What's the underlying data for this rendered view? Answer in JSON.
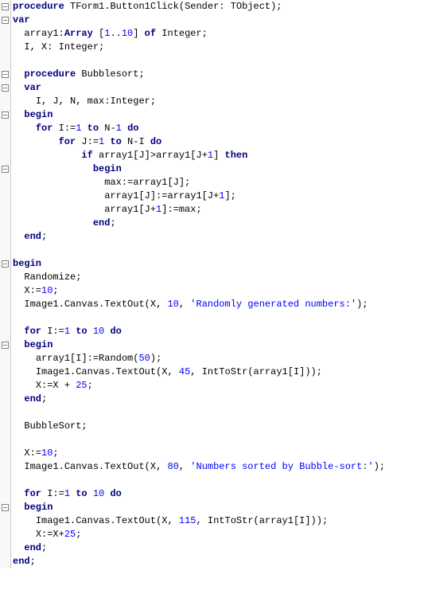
{
  "code": {
    "lines": [
      {
        "fold": true,
        "indent": 0,
        "tokens": [
          [
            "kw",
            "procedure"
          ],
          [
            "op",
            " "
          ],
          [
            "ident",
            "TForm1"
          ],
          [
            "op",
            "."
          ],
          [
            "ident",
            "Button1Click"
          ],
          [
            "op",
            "("
          ],
          [
            "ident",
            "Sender"
          ],
          [
            "op",
            ": "
          ],
          [
            "ident",
            "TObject"
          ],
          [
            "op",
            ");"
          ]
        ]
      },
      {
        "fold": true,
        "indent": 0,
        "tokens": [
          [
            "kw",
            "var"
          ]
        ]
      },
      {
        "fold": false,
        "indent": 2,
        "tokens": [
          [
            "ident",
            "array1"
          ],
          [
            "op",
            ":"
          ],
          [
            "kw",
            "Array"
          ],
          [
            "op",
            " ["
          ],
          [
            "num",
            "1"
          ],
          [
            "op",
            ".."
          ],
          [
            "num",
            "10"
          ],
          [
            "op",
            "] "
          ],
          [
            "kw",
            "of"
          ],
          [
            "op",
            " "
          ],
          [
            "ident",
            "Integer"
          ],
          [
            "op",
            ";"
          ]
        ]
      },
      {
        "fold": false,
        "indent": 2,
        "tokens": [
          [
            "ident",
            "I"
          ],
          [
            "op",
            ", "
          ],
          [
            "ident",
            "X"
          ],
          [
            "op",
            ": "
          ],
          [
            "ident",
            "Integer"
          ],
          [
            "op",
            ";"
          ]
        ]
      },
      {
        "fold": false,
        "indent": 0,
        "tokens": []
      },
      {
        "fold": true,
        "indent": 2,
        "tokens": [
          [
            "kw",
            "procedure"
          ],
          [
            "op",
            " "
          ],
          [
            "ident",
            "Bubblesort"
          ],
          [
            "op",
            ";"
          ]
        ]
      },
      {
        "fold": true,
        "indent": 2,
        "tokens": [
          [
            "kw",
            "var"
          ]
        ]
      },
      {
        "fold": false,
        "indent": 4,
        "tokens": [
          [
            "ident",
            "I"
          ],
          [
            "op",
            ", "
          ],
          [
            "ident",
            "J"
          ],
          [
            "op",
            ", "
          ],
          [
            "ident",
            "N"
          ],
          [
            "op",
            ", "
          ],
          [
            "ident",
            "max"
          ],
          [
            "op",
            ":"
          ],
          [
            "ident",
            "Integer"
          ],
          [
            "op",
            ";"
          ]
        ]
      },
      {
        "fold": true,
        "indent": 2,
        "tokens": [
          [
            "kw",
            "begin"
          ]
        ]
      },
      {
        "fold": false,
        "indent": 4,
        "tokens": [
          [
            "kw",
            "for"
          ],
          [
            "op",
            " "
          ],
          [
            "ident",
            "I"
          ],
          [
            "op",
            ":="
          ],
          [
            "num",
            "1"
          ],
          [
            "op",
            " "
          ],
          [
            "kw",
            "to"
          ],
          [
            "op",
            " "
          ],
          [
            "ident",
            "N"
          ],
          [
            "op",
            "-"
          ],
          [
            "num",
            "1"
          ],
          [
            "op",
            " "
          ],
          [
            "kw",
            "do"
          ]
        ]
      },
      {
        "fold": false,
        "indent": 8,
        "tokens": [
          [
            "kw",
            "for"
          ],
          [
            "op",
            " "
          ],
          [
            "ident",
            "J"
          ],
          [
            "op",
            ":="
          ],
          [
            "num",
            "1"
          ],
          [
            "op",
            " "
          ],
          [
            "kw",
            "to"
          ],
          [
            "op",
            " "
          ],
          [
            "ident",
            "N"
          ],
          [
            "op",
            "-"
          ],
          [
            "ident",
            "I"
          ],
          [
            "op",
            " "
          ],
          [
            "kw",
            "do"
          ]
        ]
      },
      {
        "fold": false,
        "indent": 12,
        "tokens": [
          [
            "kw",
            "if"
          ],
          [
            "op",
            " "
          ],
          [
            "ident",
            "array1"
          ],
          [
            "op",
            "["
          ],
          [
            "ident",
            "J"
          ],
          [
            "op",
            "]>"
          ],
          [
            "ident",
            "array1"
          ],
          [
            "op",
            "["
          ],
          [
            "ident",
            "J"
          ],
          [
            "op",
            "+"
          ],
          [
            "num",
            "1"
          ],
          [
            "op",
            "] "
          ],
          [
            "kw",
            "then"
          ]
        ]
      },
      {
        "fold": true,
        "indent": 14,
        "tokens": [
          [
            "kw",
            "begin"
          ]
        ]
      },
      {
        "fold": false,
        "indent": 16,
        "tokens": [
          [
            "ident",
            "max"
          ],
          [
            "op",
            ":="
          ],
          [
            "ident",
            "array1"
          ],
          [
            "op",
            "["
          ],
          [
            "ident",
            "J"
          ],
          [
            "op",
            "];"
          ]
        ]
      },
      {
        "fold": false,
        "indent": 16,
        "tokens": [
          [
            "ident",
            "array1"
          ],
          [
            "op",
            "["
          ],
          [
            "ident",
            "J"
          ],
          [
            "op",
            "]:="
          ],
          [
            "ident",
            "array1"
          ],
          [
            "op",
            "["
          ],
          [
            "ident",
            "J"
          ],
          [
            "op",
            "+"
          ],
          [
            "num",
            "1"
          ],
          [
            "op",
            "];"
          ]
        ]
      },
      {
        "fold": false,
        "indent": 16,
        "tokens": [
          [
            "ident",
            "array1"
          ],
          [
            "op",
            "["
          ],
          [
            "ident",
            "J"
          ],
          [
            "op",
            "+"
          ],
          [
            "num",
            "1"
          ],
          [
            "op",
            "]:="
          ],
          [
            "ident",
            "max"
          ],
          [
            "op",
            ";"
          ]
        ]
      },
      {
        "fold": false,
        "indent": 14,
        "tokens": [
          [
            "kw",
            "end"
          ],
          [
            "op",
            ";"
          ]
        ]
      },
      {
        "fold": false,
        "indent": 2,
        "tokens": [
          [
            "kw",
            "end"
          ],
          [
            "op",
            ";"
          ]
        ]
      },
      {
        "fold": false,
        "indent": 0,
        "tokens": []
      },
      {
        "fold": true,
        "indent": 0,
        "tokens": [
          [
            "kw",
            "begin"
          ]
        ]
      },
      {
        "fold": false,
        "indent": 2,
        "tokens": [
          [
            "ident",
            "Randomize"
          ],
          [
            "op",
            ";"
          ]
        ]
      },
      {
        "fold": false,
        "indent": 2,
        "tokens": [
          [
            "ident",
            "X"
          ],
          [
            "op",
            ":="
          ],
          [
            "num",
            "10"
          ],
          [
            "op",
            ";"
          ]
        ]
      },
      {
        "fold": false,
        "indent": 2,
        "tokens": [
          [
            "ident",
            "Image1"
          ],
          [
            "op",
            "."
          ],
          [
            "ident",
            "Canvas"
          ],
          [
            "op",
            "."
          ],
          [
            "ident",
            "TextOut"
          ],
          [
            "op",
            "("
          ],
          [
            "ident",
            "X"
          ],
          [
            "op",
            ", "
          ],
          [
            "num",
            "10"
          ],
          [
            "op",
            ", "
          ],
          [
            "str",
            "'Randomly generated numbers:'"
          ],
          [
            "op",
            ");"
          ]
        ]
      },
      {
        "fold": false,
        "indent": 0,
        "tokens": []
      },
      {
        "fold": false,
        "indent": 2,
        "tokens": [
          [
            "kw",
            "for"
          ],
          [
            "op",
            " "
          ],
          [
            "ident",
            "I"
          ],
          [
            "op",
            ":="
          ],
          [
            "num",
            "1"
          ],
          [
            "op",
            " "
          ],
          [
            "kw",
            "to"
          ],
          [
            "op",
            " "
          ],
          [
            "num",
            "10"
          ],
          [
            "op",
            " "
          ],
          [
            "kw",
            "do"
          ]
        ]
      },
      {
        "fold": true,
        "indent": 2,
        "tokens": [
          [
            "kw",
            "begin"
          ]
        ]
      },
      {
        "fold": false,
        "indent": 4,
        "tokens": [
          [
            "ident",
            "array1"
          ],
          [
            "op",
            "["
          ],
          [
            "ident",
            "I"
          ],
          [
            "op",
            "]:="
          ],
          [
            "ident",
            "Random"
          ],
          [
            "op",
            "("
          ],
          [
            "num",
            "50"
          ],
          [
            "op",
            ");"
          ]
        ]
      },
      {
        "fold": false,
        "indent": 4,
        "tokens": [
          [
            "ident",
            "Image1"
          ],
          [
            "op",
            "."
          ],
          [
            "ident",
            "Canvas"
          ],
          [
            "op",
            "."
          ],
          [
            "ident",
            "TextOut"
          ],
          [
            "op",
            "("
          ],
          [
            "ident",
            "X"
          ],
          [
            "op",
            ", "
          ],
          [
            "num",
            "45"
          ],
          [
            "op",
            ", "
          ],
          [
            "ident",
            "IntToStr"
          ],
          [
            "op",
            "("
          ],
          [
            "ident",
            "array1"
          ],
          [
            "op",
            "["
          ],
          [
            "ident",
            "I"
          ],
          [
            "op",
            "]));"
          ]
        ]
      },
      {
        "fold": false,
        "indent": 4,
        "tokens": [
          [
            "ident",
            "X"
          ],
          [
            "op",
            ":="
          ],
          [
            "ident",
            "X"
          ],
          [
            "op",
            " + "
          ],
          [
            "num",
            "25"
          ],
          [
            "op",
            ";"
          ]
        ]
      },
      {
        "fold": false,
        "indent": 2,
        "tokens": [
          [
            "kw",
            "end"
          ],
          [
            "op",
            ";"
          ]
        ]
      },
      {
        "fold": false,
        "indent": 0,
        "tokens": []
      },
      {
        "fold": false,
        "indent": 2,
        "tokens": [
          [
            "ident",
            "BubbleSort"
          ],
          [
            "op",
            ";"
          ]
        ]
      },
      {
        "fold": false,
        "indent": 0,
        "tokens": []
      },
      {
        "fold": false,
        "indent": 2,
        "tokens": [
          [
            "ident",
            "X"
          ],
          [
            "op",
            ":="
          ],
          [
            "num",
            "10"
          ],
          [
            "op",
            ";"
          ]
        ]
      },
      {
        "fold": false,
        "indent": 2,
        "tokens": [
          [
            "ident",
            "Image1"
          ],
          [
            "op",
            "."
          ],
          [
            "ident",
            "Canvas"
          ],
          [
            "op",
            "."
          ],
          [
            "ident",
            "TextOut"
          ],
          [
            "op",
            "("
          ],
          [
            "ident",
            "X"
          ],
          [
            "op",
            ", "
          ],
          [
            "num",
            "80"
          ],
          [
            "op",
            ", "
          ],
          [
            "str",
            "'Numbers sorted by Bubble-sort:'"
          ],
          [
            "op",
            ");"
          ]
        ]
      },
      {
        "fold": false,
        "indent": 0,
        "tokens": []
      },
      {
        "fold": false,
        "indent": 2,
        "tokens": [
          [
            "kw",
            "for"
          ],
          [
            "op",
            " "
          ],
          [
            "ident",
            "I"
          ],
          [
            "op",
            ":="
          ],
          [
            "num",
            "1"
          ],
          [
            "op",
            " "
          ],
          [
            "kw",
            "to"
          ],
          [
            "op",
            " "
          ],
          [
            "num",
            "10"
          ],
          [
            "op",
            " "
          ],
          [
            "kw",
            "do"
          ]
        ]
      },
      {
        "fold": true,
        "indent": 2,
        "tokens": [
          [
            "kw",
            "begin"
          ]
        ]
      },
      {
        "fold": false,
        "indent": 4,
        "tokens": [
          [
            "ident",
            "Image1"
          ],
          [
            "op",
            "."
          ],
          [
            "ident",
            "Canvas"
          ],
          [
            "op",
            "."
          ],
          [
            "ident",
            "TextOut"
          ],
          [
            "op",
            "("
          ],
          [
            "ident",
            "X"
          ],
          [
            "op",
            ", "
          ],
          [
            "num",
            "115"
          ],
          [
            "op",
            ", "
          ],
          [
            "ident",
            "IntToStr"
          ],
          [
            "op",
            "("
          ],
          [
            "ident",
            "array1"
          ],
          [
            "op",
            "["
          ],
          [
            "ident",
            "I"
          ],
          [
            "op",
            "]));"
          ]
        ]
      },
      {
        "fold": false,
        "indent": 4,
        "tokens": [
          [
            "ident",
            "X"
          ],
          [
            "op",
            ":="
          ],
          [
            "ident",
            "X"
          ],
          [
            "op",
            "+"
          ],
          [
            "num",
            "25"
          ],
          [
            "op",
            ";"
          ]
        ]
      },
      {
        "fold": false,
        "indent": 2,
        "tokens": [
          [
            "kw",
            "end"
          ],
          [
            "op",
            ";"
          ]
        ]
      },
      {
        "fold": false,
        "indent": 0,
        "tokens": [
          [
            "kw",
            "end"
          ],
          [
            "op",
            ";"
          ]
        ]
      }
    ]
  }
}
